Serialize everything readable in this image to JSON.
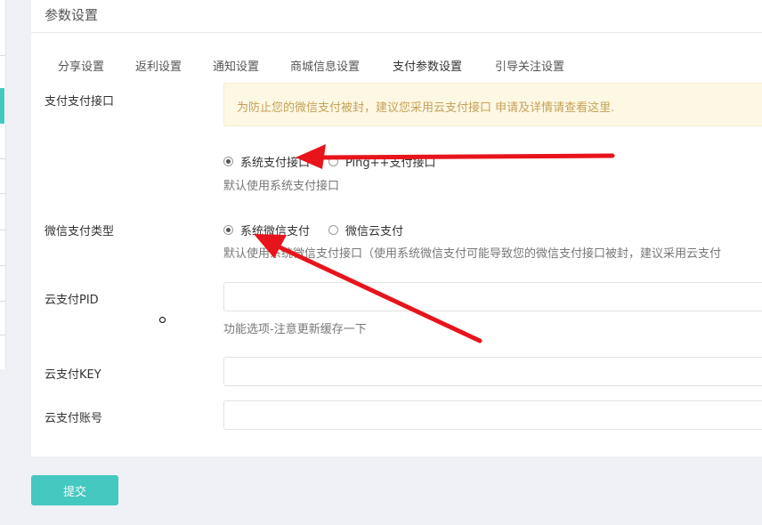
{
  "panel": {
    "title": "参数设置"
  },
  "tabs": [
    {
      "label": "分享设置"
    },
    {
      "label": "返利设置"
    },
    {
      "label": "通知设置"
    },
    {
      "label": "商城信息设置"
    },
    {
      "label": "支付参数设置"
    },
    {
      "label": "引导关注设置"
    }
  ],
  "pay_interface": {
    "label": "支付支付接口",
    "notice": "为防止您的微信支付被封，建议您采用云支付接口 申请及详情请查看这里.",
    "options": [
      {
        "label": "系统支付接口",
        "checked": true
      },
      {
        "label": "Ping++支付接口",
        "checked": false
      }
    ],
    "help": "默认使用系统支付接口"
  },
  "wechat_pay_type": {
    "label": "微信支付类型",
    "options": [
      {
        "label": "系统微信支付",
        "checked": true
      },
      {
        "label": "微信云支付",
        "checked": false
      }
    ],
    "help": "默认使用系统微信支付接口（使用系统微信支付可能导致您的微信支付接口被封，建议采用云支付"
  },
  "cloud_pid": {
    "label": "云支付PID",
    "value": "",
    "help": "功能选项-注意更新缓存一下"
  },
  "cloud_key": {
    "label": "云支付KEY",
    "value": ""
  },
  "cloud_account": {
    "label": "云支付账号",
    "value": ""
  },
  "submit": {
    "label": "提交"
  },
  "colors": {
    "accent": "#44c8c0",
    "annotation_arrow": "#e8141b",
    "notice_bg": "#fcf8e3",
    "notice_text": "#c7a05a"
  }
}
